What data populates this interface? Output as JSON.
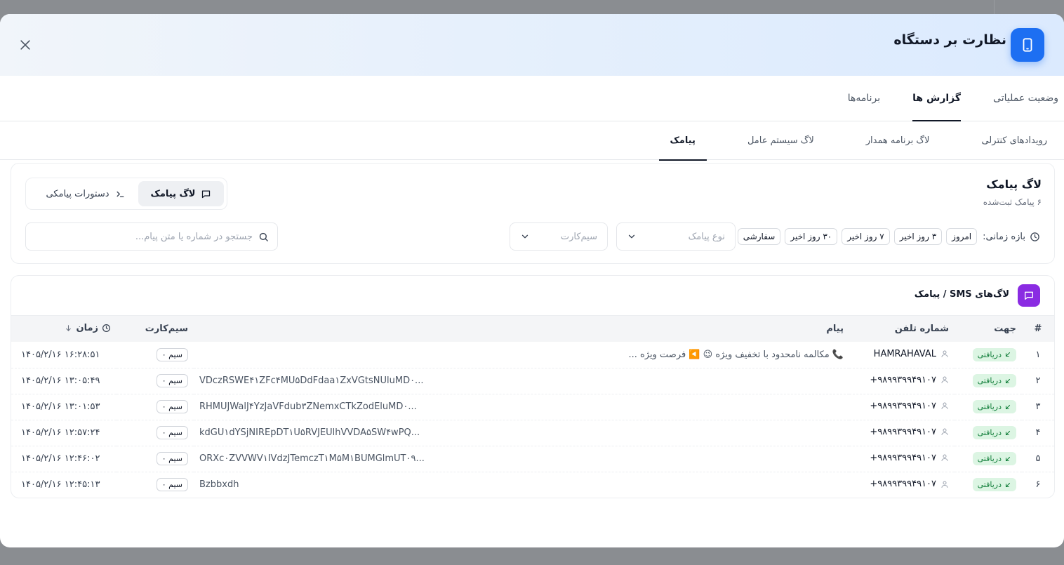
{
  "modal": {
    "title": "نظارت بر دستگاه",
    "close_icon": "close-icon",
    "header_icon": "smartphone-icon"
  },
  "main_tabs": [
    {
      "label": "وضعیت عملیاتی",
      "active": false
    },
    {
      "label": "گزارش ها",
      "active": true
    },
    {
      "label": "برنامه‌ها",
      "active": false
    }
  ],
  "sub_tabs": [
    {
      "label": "رویدادهای کنترلی",
      "active": false
    },
    {
      "label": "لاگ برنامه همدار",
      "active": false
    },
    {
      "label": "لاگ سیستم عامل",
      "active": false
    },
    {
      "label": "پیامک",
      "active": true
    }
  ],
  "filter_card": {
    "title": "لاگ پیامک",
    "subtitle": "۶ پیامک ثبت‌شده",
    "segment": {
      "log_label": "لاگ پیامک",
      "commands_label": "دستورات پیامکی"
    },
    "time_range_label": "بازه زمانی:",
    "time_chips": [
      "امروز",
      "۳ روز اخیر",
      "۷ روز اخیر",
      "۳۰ روز اخیر",
      "سفارشی"
    ],
    "message_type_placeholder": "نوع پیامک",
    "sim_placeholder": "سیم‌کارت",
    "search_placeholder": "جستجو در شماره یا متن پیام..."
  },
  "table": {
    "title": "لاگ‌های SMS / پیامک",
    "columns": {
      "index": "#",
      "direction": "جهت",
      "phone": "شماره تلفن",
      "message": "پیام",
      "sim": "سیم‌کارت",
      "time": "زمان"
    },
    "rows": [
      {
        "index": "۱",
        "direction": "دریافتی",
        "phone": "HAMRAHAVAL",
        "message": "📞 مکالمه نامحدود با تخفیف ویژه 😉 ◀️ فرصت ویژه ...",
        "sim": "سیم ۰",
        "time": "۱۴۰۵/۲/۱۶ ۱۶:۲۸:۵۱"
      },
      {
        "index": "۲",
        "direction": "دریافتی",
        "phone": "+۹۸۹۹۳۹۹۴۹۱۰۷",
        "message": "VDczRSWE۴۱ZFc۴MU۵DdFdaa۱ZxVGtsNUluMD۰...",
        "sim": "سیم ۰",
        "time": "۱۴۰۵/۲/۱۶ ۱۳:۰۵:۴۹"
      },
      {
        "index": "۳",
        "direction": "دریافتی",
        "phone": "+۹۸۹۹۳۹۹۴۹۱۰۷",
        "message": "RHMUJWalJ۴YzJaVFdub۳ZNemxCTkZodEluMD۰...",
        "sim": "سیم ۰",
        "time": "۱۴۰۵/۲/۱۶ ۱۳:۰۱:۵۳"
      },
      {
        "index": "۴",
        "direction": "دریافتی",
        "phone": "+۹۸۹۹۳۹۹۴۹۱۰۷",
        "message": "kdGU۱dYSjNIREpDT۱U۵RVJEUlhVVDA۵SW۴wPQ...",
        "sim": "سیم ۰",
        "time": "۱۴۰۵/۲/۱۶ ۱۲:۵۷:۲۴"
      },
      {
        "index": "۵",
        "direction": "دریافتی",
        "phone": "+۹۸۹۹۳۹۹۴۹۱۰۷",
        "message": "ORXc۰ZVVWV۱IVdzJTemczT۱M۵M۱BUMGlmUT۰۹...",
        "sim": "سیم ۰",
        "time": "۱۴۰۵/۲/۱۶ ۱۲:۴۶:۰۲"
      },
      {
        "index": "۶",
        "direction": "دریافتی",
        "phone": "+۹۸۹۹۳۹۹۴۹۱۰۷",
        "message": "Bzbbxdh",
        "sim": "سیم ۰",
        "time": "۱۴۰۵/۲/۱۶ ۱۲:۴۵:۱۳"
      }
    ]
  },
  "colors": {
    "primary": "#1d6ff2",
    "accent_purple": "#8a2be2",
    "incoming_badge_bg": "#dcf5e3",
    "incoming_badge_text": "#15803d"
  }
}
